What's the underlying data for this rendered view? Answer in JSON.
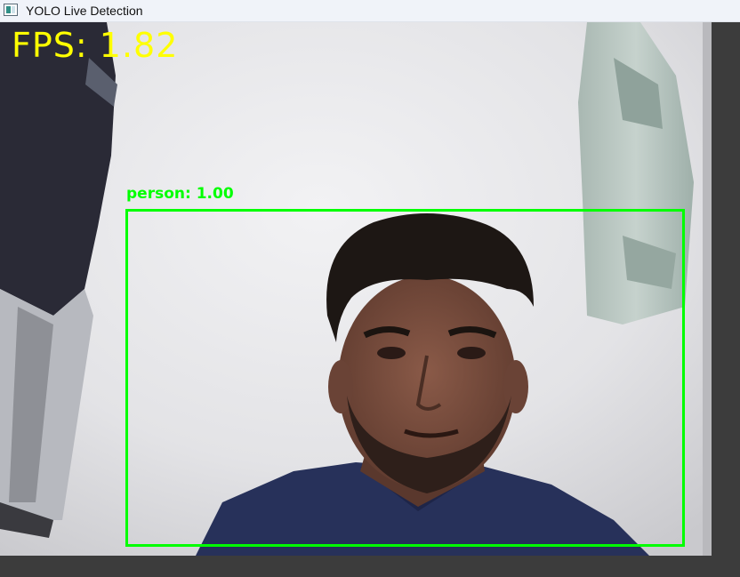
{
  "window": {
    "title": "YOLO Live Detection",
    "icon": "app-window-icon"
  },
  "overlay": {
    "fps_text": "FPS: 1.82",
    "fps_color": "#ffff00"
  },
  "detections": [
    {
      "label_text": "person: 1.00",
      "class": "person",
      "confidence": 1.0,
      "color": "#00ff00"
    }
  ],
  "colors": {
    "window_background": "#3c3c3c",
    "titlebar_background": "#f0f3f9"
  }
}
